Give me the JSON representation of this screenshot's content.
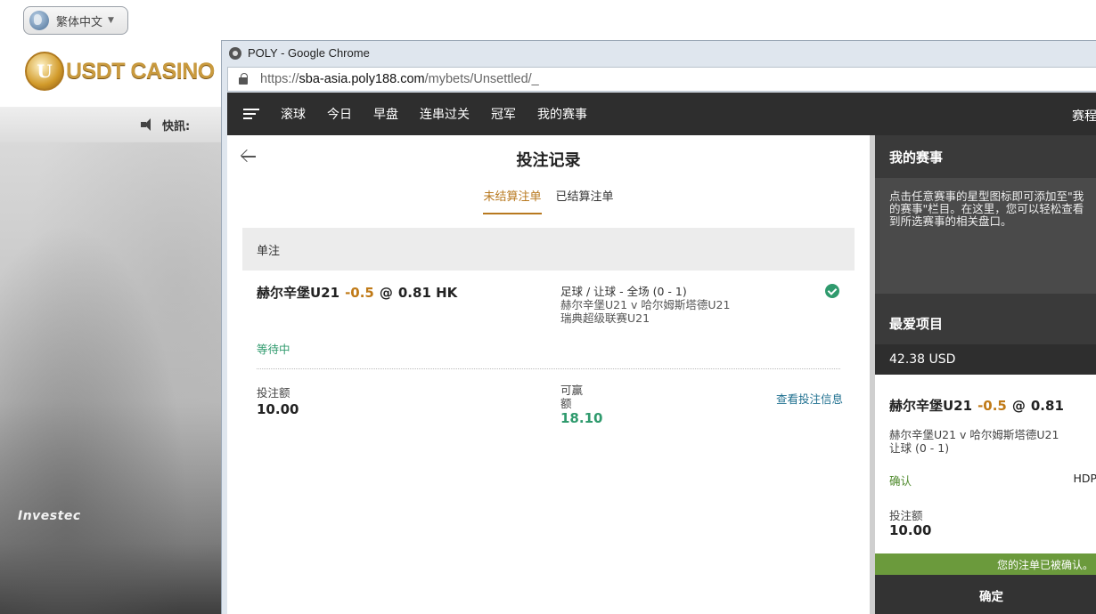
{
  "background": {
    "language": "繁体中文",
    "logo_text": "USDT CASINO",
    "logo_mark": "U",
    "news_label": "快訊:",
    "photo_sign": "Investec"
  },
  "chrome": {
    "title": "POLY - Google Chrome",
    "url_prefix": "https://",
    "url_host": "sba-asia.poly188.com",
    "url_path": "/mybets/Unsettled/_"
  },
  "nav": {
    "items": [
      "滚球",
      "今日",
      "早盘",
      "连串过关",
      "冠军",
      "我的赛事"
    ],
    "schedule": "赛程"
  },
  "bets": {
    "title": "投注记录",
    "tabs": [
      "未结算注单",
      "已结算注单"
    ],
    "section": "单注",
    "item": {
      "team": "赫尔辛堡U21",
      "handicap": "-0.5",
      "at": "@",
      "odds": "0.81 HK",
      "market": "足球 / 让球 - 全场 (0 - 1)",
      "match": "赫尔辛堡U21 v 哈尔姆斯塔德U21",
      "league": "瑞典超级联赛U21",
      "status": "等待中",
      "stake_label": "投注额",
      "stake": "10.00",
      "win_label_1": "可赢",
      "win_label_2": "额",
      "win": "18.10",
      "view_info": "查看投注信息"
    }
  },
  "right": {
    "my_events_title": "我的赛事",
    "my_events_desc_1": "点击任意赛事的星型图标即可添加至\"我",
    "my_events_desc_2": "的赛事\"栏目。在这里，您可以轻松查看",
    "my_events_desc_3": "到所选赛事的相关盘口。",
    "favorites_title": "最爱项目",
    "balance": "42.38 USD",
    "slip": {
      "team": "赫尔辛堡U21",
      "handicap": "-0.5",
      "at": "@",
      "odds": "0.81",
      "match": "赫尔辛堡U21 v 哈尔姆斯塔德U21",
      "market": "让球 (0 - 1)",
      "confirm": "确认",
      "type": "HDP",
      "stake_label": "投注额",
      "stake": "10.00"
    },
    "message": "您的注单已被确认。",
    "confirm_button": "确定"
  },
  "colors": {
    "accent_orange": "#b8791f",
    "status_green": "#2f9a6d",
    "confirm_bar_green": "#6b9a3c",
    "nav_dark": "#2e2e2e"
  }
}
